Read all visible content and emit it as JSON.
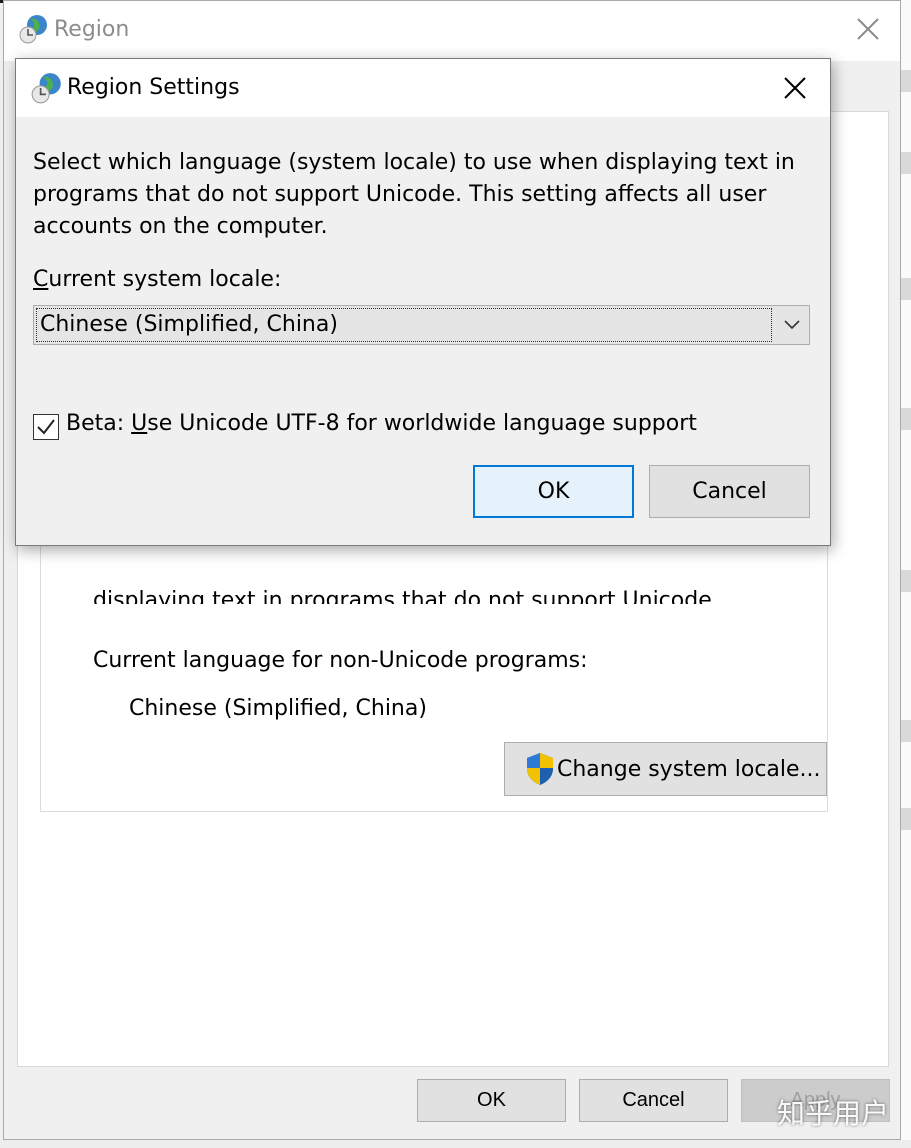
{
  "region_window": {
    "title": "Region",
    "partial_text": "displaying text in programs that do not support Unicode.",
    "current_language_label": "Current language for non-Unicode programs:",
    "current_language_value": "Chinese (Simplified, China)",
    "change_locale_button": "Change system locale...",
    "footer": {
      "ok": "OK",
      "cancel": "Cancel",
      "apply": "Apply"
    }
  },
  "dialog": {
    "title": "Region Settings",
    "description": "Select which language (system locale) to use when displaying text in programs that do not support Unicode. This setting affects all user accounts on the computer.",
    "locale_label_first": "C",
    "locale_label_rest": "urrent system locale:",
    "locale_selected": "Chinese (Simplified, China)",
    "utf8_checked": true,
    "utf8_label_prefix": "Beta: ",
    "utf8_label_accel": "U",
    "utf8_label_rest": "se Unicode UTF-8 for worldwide language support",
    "ok": "OK",
    "cancel": "Cancel"
  },
  "watermark": "知乎用户",
  "colors": {
    "focus_border": "#0078d7",
    "button_bg": "#e1e1e1",
    "dialog_bg": "#f0f0f0"
  }
}
